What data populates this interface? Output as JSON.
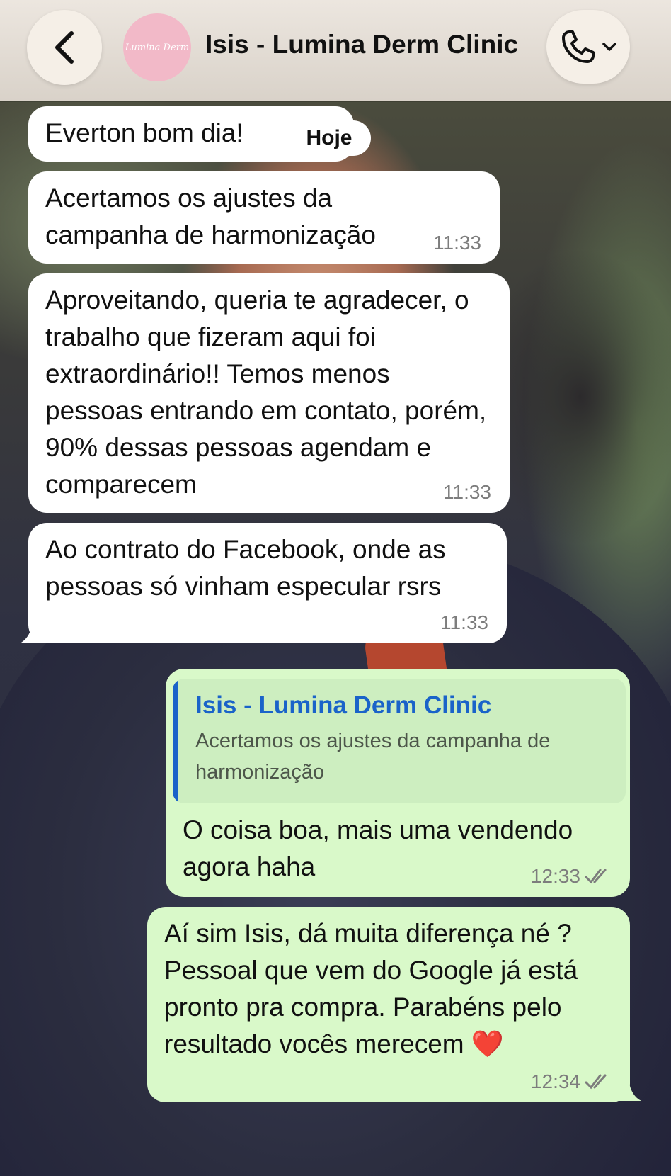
{
  "header": {
    "contact_name": "Isis - Lumina Derm Clinic",
    "avatar_text": "Lumina Derm",
    "avatar_color": "#f2b9c8"
  },
  "date_pill": "Hoje",
  "messages": [
    {
      "direction": "incoming",
      "text": "Everton bom dia!"
    },
    {
      "direction": "incoming",
      "text": "Acertamos os ajustes da campanha de harmonização",
      "time": "11:33"
    },
    {
      "direction": "incoming",
      "text": "Aproveitando, queria te agradecer, o trabalho que fizeram aqui foi extraordinário!! Temos menos pessoas entrando em contato, porém, 90% dessas pessoas agendam e comparecem",
      "time": "11:33"
    },
    {
      "direction": "incoming",
      "text": "Ao contrato do Facebook, onde as pessoas só vinham especular rsrs",
      "time": "11:33"
    },
    {
      "direction": "outgoing",
      "quote": {
        "author": "Isis - Lumina Derm Clinic",
        "text": "Acertamos os ajustes da campanha de harmonização"
      },
      "text": "O coisa boa, mais uma vendendo agora haha",
      "time": "12:33",
      "status": "read"
    },
    {
      "direction": "outgoing",
      "text": "Aí sim Isis, dá muita diferença né ? Pessoal que vem do Google já está pronto pra compra. Parabéns pelo resultado vocês merecem ❤️",
      "time": "12:34",
      "status": "read"
    }
  ],
  "colors": {
    "incoming_bubble": "#ffffff",
    "outgoing_bubble": "#d9f9c9",
    "quote_accent": "#1a63c9",
    "time_text": "#7d7d7d"
  },
  "icons": {
    "back": "chevron-left-icon",
    "call": "phone-icon",
    "call_menu": "chevron-down-icon",
    "read_status": "double-check-icon"
  }
}
